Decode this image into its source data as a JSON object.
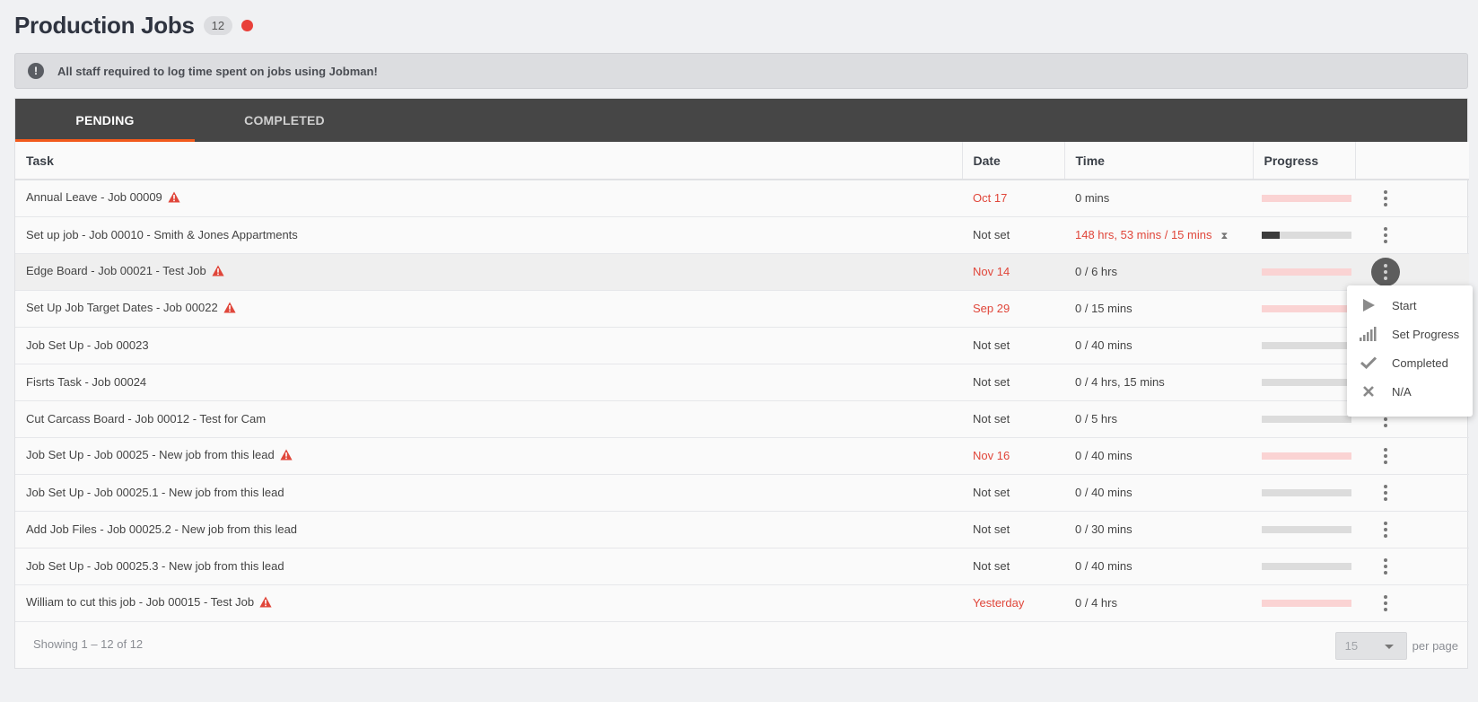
{
  "header": {
    "title": "Production Jobs",
    "count": "12",
    "status_color": "#e8403a"
  },
  "notice": {
    "icon": "exclamation-circle-icon",
    "text": "All staff required to log time spent on jobs using Jobman!"
  },
  "tabs": [
    {
      "label": "PENDING",
      "active": true
    },
    {
      "label": "COMPLETED",
      "active": false
    }
  ],
  "accent_color": "#f25a1c",
  "table": {
    "columns": [
      "Task",
      "Date",
      "Time",
      "Progress"
    ],
    "rows": [
      {
        "task": "Annual Leave - Job 00009",
        "warning": true,
        "date": "Oct 17",
        "date_overdue": true,
        "time": "0 mins",
        "time_over": false,
        "progress": 0,
        "overdue": true
      },
      {
        "task": "Set up job - Job 00010 - Smith & Jones Appartments",
        "warning": false,
        "date": "Not set",
        "date_overdue": false,
        "time": "148 hrs, 53 mins / 15 mins",
        "time_over": true,
        "progress": 0.2,
        "overdue": false
      },
      {
        "task": "Edge Board - Job 00021 - Test Job",
        "warning": true,
        "date": "Nov 14",
        "date_overdue": true,
        "time": "0 / 6 hrs",
        "time_over": false,
        "progress": 0,
        "overdue": true
      },
      {
        "task": "Set Up Job Target Dates - Job 00022",
        "warning": true,
        "date": "Sep 29",
        "date_overdue": true,
        "time": "0 / 15 mins",
        "time_over": false,
        "progress": 0,
        "overdue": true
      },
      {
        "task": "Job Set Up - Job 00023",
        "warning": false,
        "date": "Not set",
        "date_overdue": false,
        "time": "0 / 40 mins",
        "time_over": false,
        "progress": 0,
        "overdue": false
      },
      {
        "task": "Fisrts Task - Job 00024",
        "warning": false,
        "date": "Not set",
        "date_overdue": false,
        "time": "0 / 4 hrs, 15 mins",
        "time_over": false,
        "progress": 0,
        "overdue": false
      },
      {
        "task": "Cut Carcass Board - Job 00012 - Test for Cam",
        "warning": false,
        "date": "Not set",
        "date_overdue": false,
        "time": "0 / 5 hrs",
        "time_over": false,
        "progress": 0,
        "overdue": false
      },
      {
        "task": "Job Set Up - Job 00025 - New job from this lead",
        "warning": true,
        "date": "Nov 16",
        "date_overdue": true,
        "time": "0 / 40 mins",
        "time_over": false,
        "progress": 0,
        "overdue": true
      },
      {
        "task": "Job Set Up - Job 00025.1 - New job from this lead",
        "warning": false,
        "date": "Not set",
        "date_overdue": false,
        "time": "0 / 40 mins",
        "time_over": false,
        "progress": 0,
        "overdue": false
      },
      {
        "task": "Add Job Files - Job 00025.2 - New job from this lead",
        "warning": false,
        "date": "Not set",
        "date_overdue": false,
        "time": "0 / 30 mins",
        "time_over": false,
        "progress": 0,
        "overdue": false
      },
      {
        "task": "Job Set Up - Job 00025.3 - New job from this lead",
        "warning": false,
        "date": "Not set",
        "date_overdue": false,
        "time": "0 / 40 mins",
        "time_over": false,
        "progress": 0,
        "overdue": false
      },
      {
        "task": "William to cut this job - Job 00015 - Test Job",
        "warning": true,
        "date": "Yesterday",
        "date_overdue": true,
        "time": "0 / 4 hrs",
        "time_over": false,
        "progress": 0,
        "overdue": true
      }
    ]
  },
  "highlight_row": 2,
  "footer": {
    "showing": "Showing 1 – 12 of 12",
    "per_page_value": "15",
    "per_page_label": "per page"
  },
  "context_menu": [
    {
      "label": "Start",
      "icon": "play-icon"
    },
    {
      "label": "Set Progress",
      "icon": "signal-bars-icon"
    },
    {
      "label": "Completed",
      "icon": "check-icon"
    },
    {
      "label": "N/A",
      "icon": "close-icon"
    }
  ]
}
